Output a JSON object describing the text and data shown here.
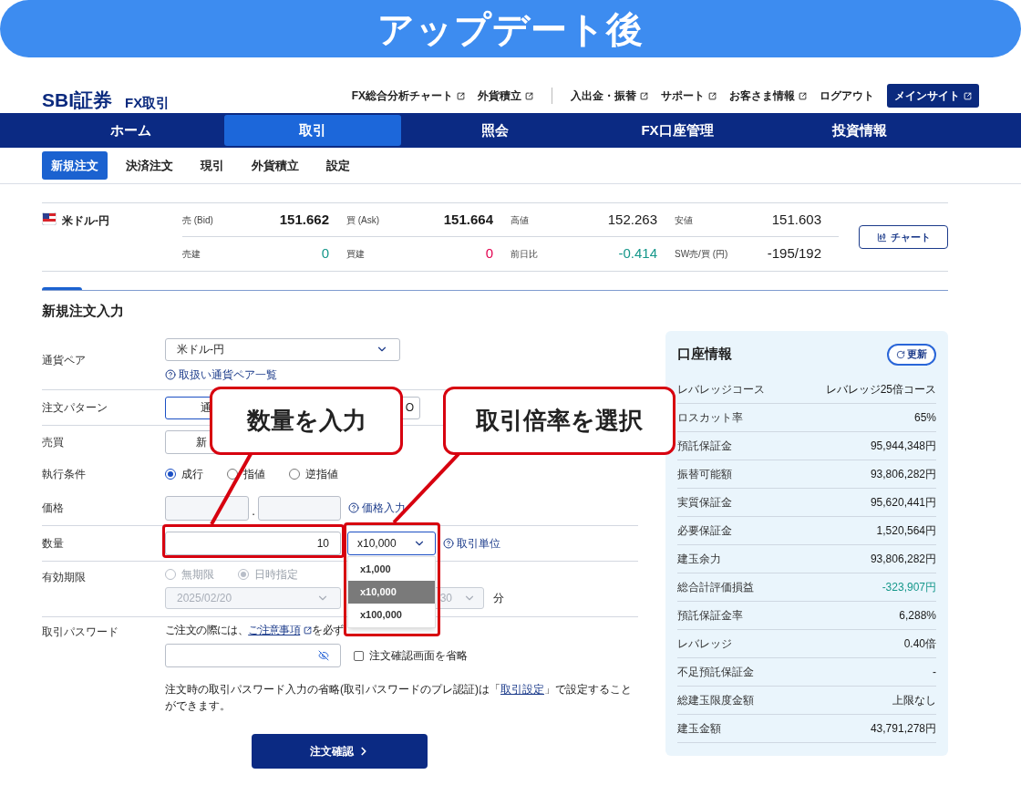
{
  "banner": {
    "title": "アップデート後"
  },
  "header": {
    "logo": "SBI証券",
    "product": "FX取引",
    "links": [
      {
        "label": "FX総合分析チャート",
        "external": true,
        "divider_before": false
      },
      {
        "label": "外貨積立",
        "external": true,
        "divider_before": false
      },
      {
        "label": "入出金・振替",
        "external": true,
        "divider_before": true
      },
      {
        "label": "サポート",
        "external": true,
        "divider_before": false
      },
      {
        "label": "お客さま情報",
        "external": true,
        "divider_before": false
      },
      {
        "label": "ログアウト",
        "external": false,
        "divider_before": false
      }
    ],
    "main_site": "メインサイト"
  },
  "nav": [
    {
      "label": "ホーム",
      "selected": false
    },
    {
      "label": "取引",
      "selected": true
    },
    {
      "label": "照会",
      "selected": false
    },
    {
      "label": "FX口座管理",
      "selected": false
    },
    {
      "label": "投資情報",
      "selected": false
    }
  ],
  "subnav": [
    {
      "label": "新規注文",
      "selected": true
    },
    {
      "label": "決済注文",
      "selected": false
    },
    {
      "label": "現引",
      "selected": false
    },
    {
      "label": "外貨積立",
      "selected": false
    },
    {
      "label": "設定",
      "selected": false
    }
  ],
  "quote": {
    "pair": "米ドル-円",
    "rows": [
      [
        {
          "label": "売 (Bid)",
          "value": "151.662",
          "bold": true
        },
        {
          "label": "買 (Ask)",
          "value": "151.664",
          "bold": true
        },
        {
          "label": "高値",
          "value": "152.263",
          "bold": false
        },
        {
          "label": "安値",
          "value": "151.603",
          "bold": false
        }
      ],
      [
        {
          "label": "売建",
          "value": "0",
          "bold": false,
          "color": "#15978a"
        },
        {
          "label": "買建",
          "value": "0",
          "bold": false,
          "color": "#e3004f"
        },
        {
          "label": "前日比",
          "value": "-0.414",
          "bold": false,
          "color": "#15978a"
        },
        {
          "label": "SW売/買 (円)",
          "value": "-195/192",
          "bold": false
        }
      ]
    ],
    "chart_button": "チャート"
  },
  "form": {
    "title": "新規注文入力",
    "currency": {
      "label": "通貨ペア",
      "value": "米ドル-円",
      "help": "取扱い通貨ペア一覧"
    },
    "pattern": {
      "label": "注文パターン",
      "options": [
        {
          "label": "通",
          "selected": true
        },
        {
          "label": "O",
          "selected": false
        }
      ]
    },
    "side": {
      "label": "売買",
      "button": "新"
    },
    "execution": {
      "label": "執行条件",
      "options": [
        {
          "label": "成行",
          "selected": true
        },
        {
          "label": "指値",
          "selected": false
        },
        {
          "label": "逆指値",
          "selected": false
        }
      ]
    },
    "price": {
      "label": "価格",
      "separator": ".",
      "help": "価格入力"
    },
    "quantity": {
      "label": "数量",
      "value": "10",
      "multiplier": "x10,000",
      "help": "取引単位",
      "dropdown": [
        {
          "label": "x1,000",
          "selected": false
        },
        {
          "label": "x10,000",
          "selected": true
        },
        {
          "label": "x100,000",
          "selected": false
        }
      ]
    },
    "expiry": {
      "label": "有効期限",
      "disabled": true,
      "options": [
        {
          "label": "無期限",
          "selected": false
        },
        {
          "label": "日時指定",
          "selected": true
        }
      ],
      "date": "2025/02/20",
      "minute": "30",
      "minute_unit": "分"
    },
    "password": {
      "label": "取引パスワード",
      "notice_before": "ご注文の際には、",
      "notice_link": "ご注意事項",
      "notice_after": "を必ず",
      "skip_confirm": {
        "label": "注文確認画面を省略",
        "checked": false
      },
      "note_before": "注文時の取引パスワード入力の省略(取引パスワードのプレ認証)は「",
      "note_link": "取引設定",
      "note_after": "」で設定することができます。"
    },
    "submit": "注文確認"
  },
  "callouts": [
    {
      "text": "数量を入力"
    },
    {
      "text": "取引倍率を選択"
    }
  ],
  "account": {
    "title": "口座情報",
    "refresh": "更新",
    "rows": [
      {
        "label": "レバレッジコース",
        "value": "レバレッジ25倍コース"
      },
      {
        "label": "ロスカット率",
        "value": "65%"
      },
      {
        "label": "預託保証金",
        "value": "95,944,348円"
      },
      {
        "label": "振替可能額",
        "value": "93,806,282円"
      },
      {
        "label": "実質保証金",
        "value": "95,620,441円"
      },
      {
        "label": "必要保証金",
        "value": "1,520,564円"
      },
      {
        "label": "建玉余力",
        "value": "93,806,282円"
      },
      {
        "label": "総合計評価損益",
        "value": "-323,907円",
        "color": "#15978a"
      },
      {
        "label": "預託保証金率",
        "value": "6,288%"
      },
      {
        "label": "レバレッジ",
        "value": "0.40倍"
      },
      {
        "label": "不足預託保証金",
        "value": "-"
      },
      {
        "label": "総建玉限度金額",
        "value": "上限なし"
      },
      {
        "label": "建玉金額",
        "value": "43,791,278円"
      }
    ]
  }
}
